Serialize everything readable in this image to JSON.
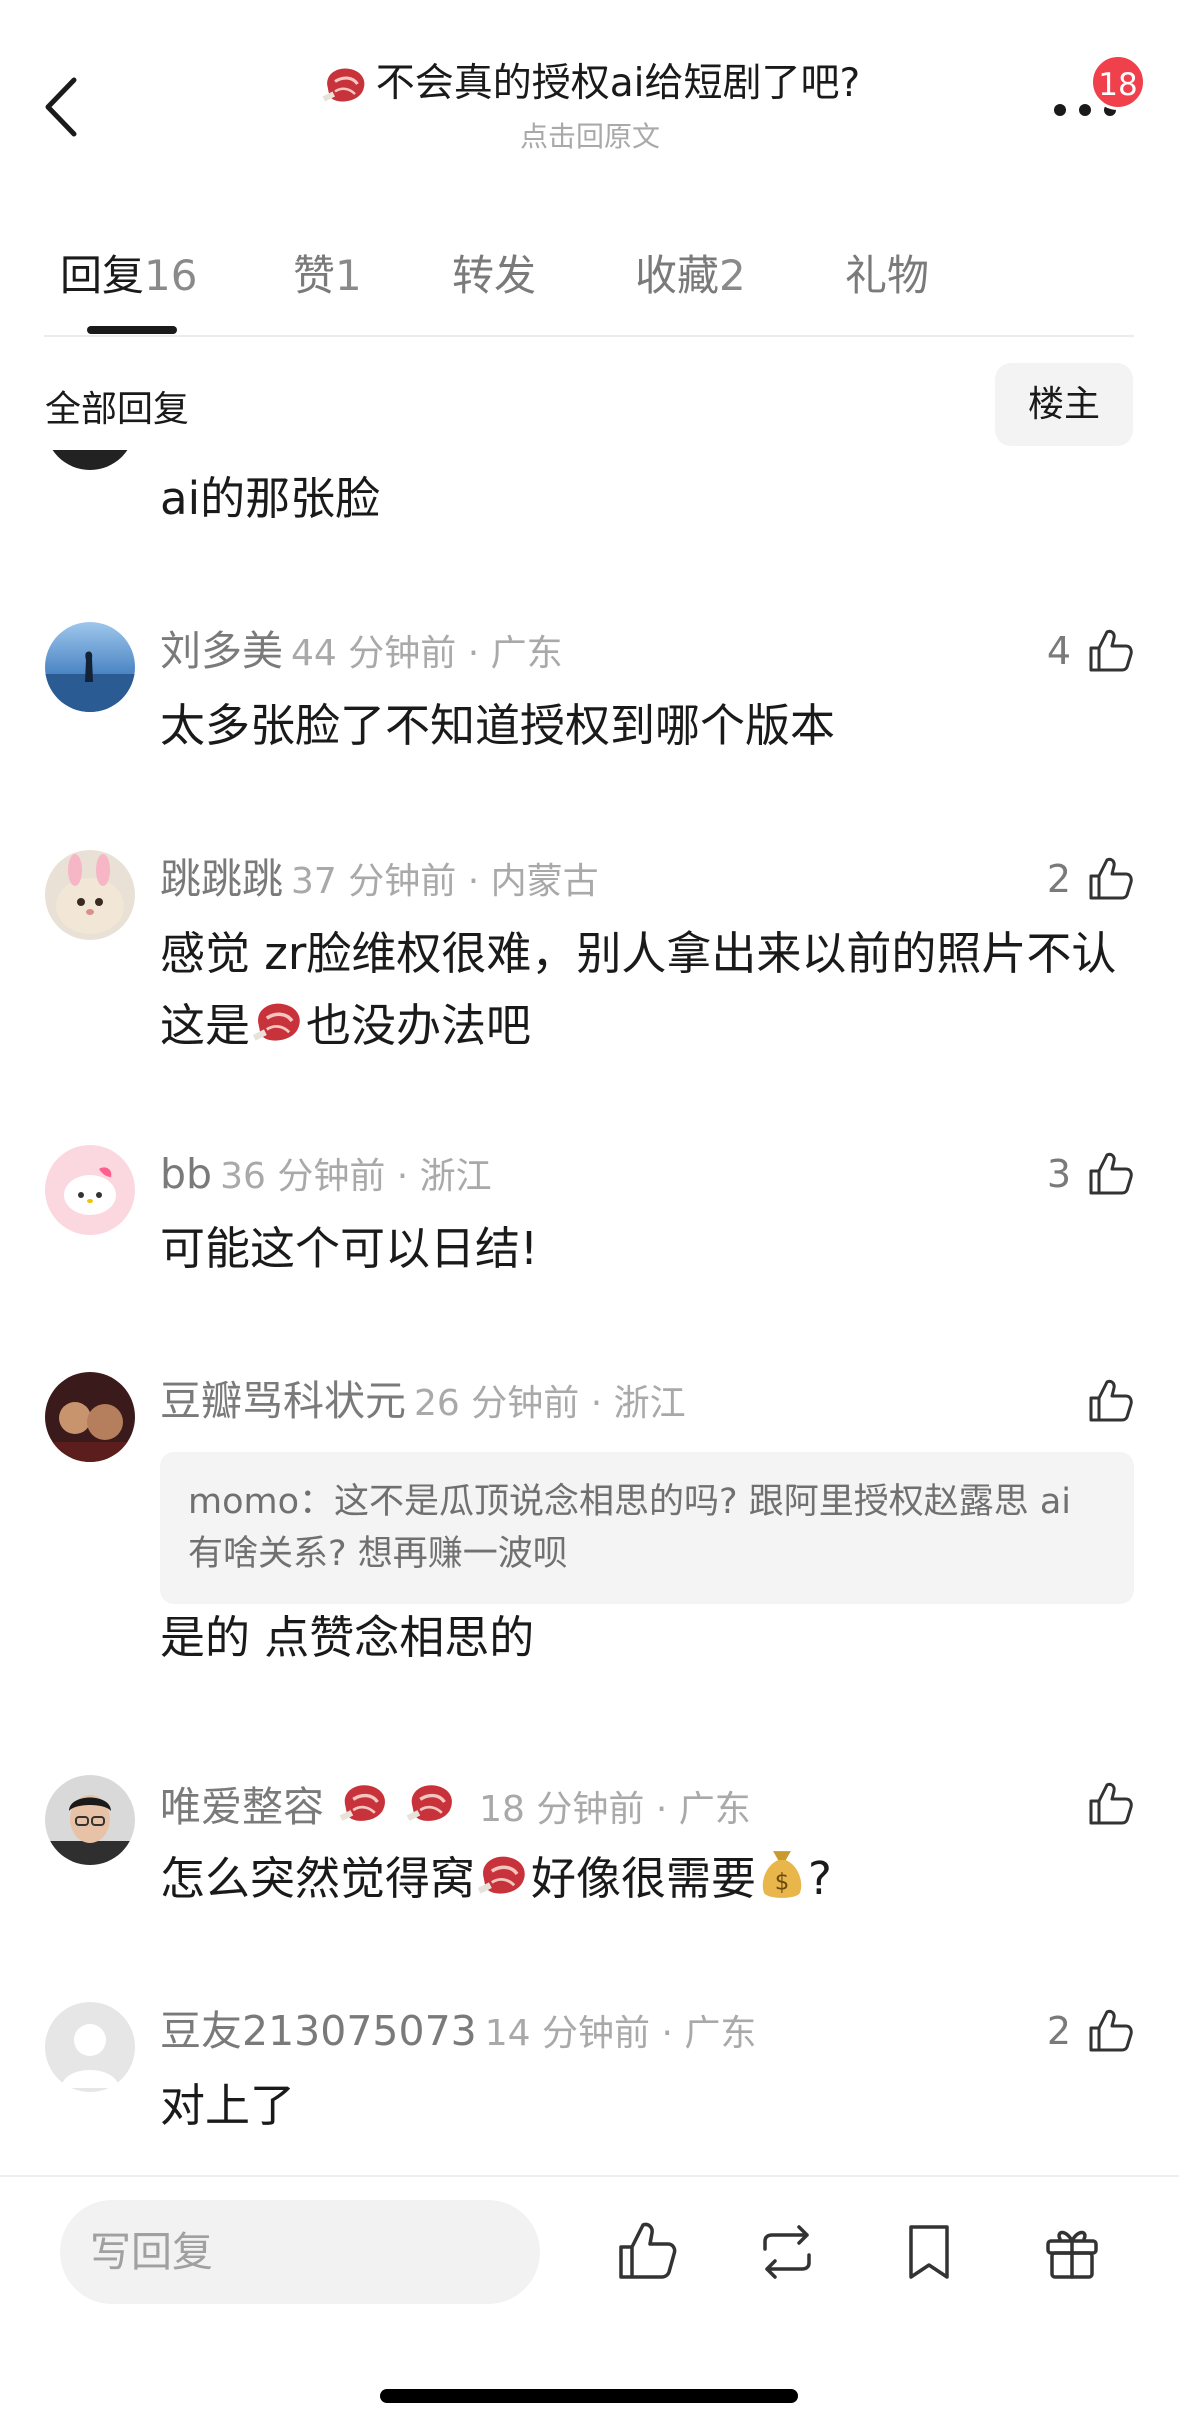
{
  "header": {
    "title": "不会真的授权ai给短剧了吧?",
    "subtitle": "点击回原文",
    "badge_count": "18",
    "icons": [
      "back-icon",
      "steak-icon",
      "more-icon"
    ]
  },
  "tabs": [
    {
      "label": "回复",
      "count": "16",
      "active": true
    },
    {
      "label": "赞",
      "count": "1"
    },
    {
      "label": "转发",
      "count": ""
    },
    {
      "label": "收藏",
      "count": "2"
    },
    {
      "label": "礼物",
      "count": ""
    }
  ],
  "filter": {
    "title": "全部回复",
    "owner_button": "楼主"
  },
  "cut_comment": {
    "text": "ai的那张脸"
  },
  "comments": [
    {
      "user": "刘多美",
      "time": "44 分钟前 · 广东",
      "likes": "4",
      "text": "太多张脸了不知道授权到哪个版本"
    },
    {
      "user": "跳跳跳",
      "time": "37 分钟前 · 内蒙古",
      "likes": "2",
      "text_a": "感觉 zr脸维权很难，别人拿出来以前的照片不认这是",
      "text_b": "也没办法吧"
    },
    {
      "user": "bb",
      "time": "36 分钟前 · 浙江",
      "likes": "3",
      "text": "可能这个可以日结!"
    },
    {
      "user": "豆瓣骂科状元",
      "time": "26 分钟前 · 浙江",
      "likes": "",
      "quote": "momo：这不是瓜顶说念相思的吗? 跟阿里授权赵露思 ai 有啥关系? 想再赚一波呗",
      "text": "是的 点赞念相思的"
    },
    {
      "user": "唯爱整容",
      "time": "18 分钟前 · 广东",
      "likes": "",
      "text_a": "怎么突然觉得窝",
      "text_b": "好像很需要",
      "text_c": "?"
    },
    {
      "user": "豆友213075073",
      "time": "14 分钟前 · 广东",
      "likes": "2",
      "text": "对上了"
    }
  ],
  "bottom_bar": {
    "reply_placeholder": "写回复",
    "icons": [
      "like-icon",
      "repost-icon",
      "bookmark-icon",
      "gift-icon"
    ]
  },
  "colors": {
    "badge": "#f0404b",
    "steak": "#c8323a",
    "text_secondary": "#7a7a7a"
  }
}
